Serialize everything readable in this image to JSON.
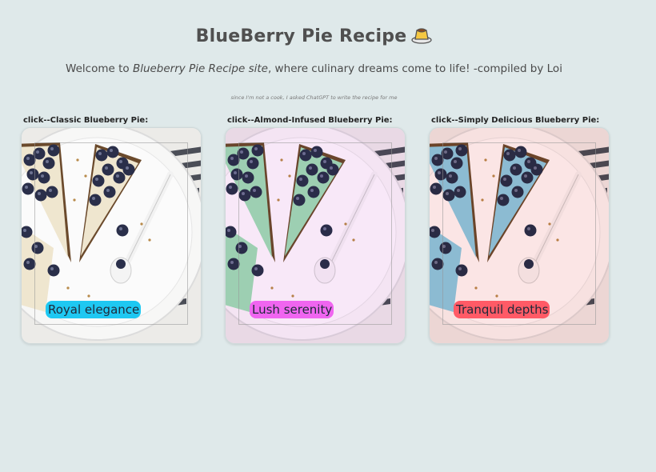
{
  "header": {
    "title": "BlueBerry Pie Recipe",
    "welcome_prefix": "Welcome to ",
    "welcome_site": "Blueberry Pie Recipe site",
    "welcome_suffix": ", where culinary dreams come to life! -compiled by Loi",
    "disclaimer": "since I'm not a cook, I asked ChatGPT to write the recipe for me"
  },
  "cards": [
    {
      "caption": "click--Classic Blueberry Pie:",
      "badge": "Royal elegance",
      "badge_color": "#1ec8f2",
      "tint": "none",
      "filling_color": "#efe6cf"
    },
    {
      "caption": "click--Almond-Infused Blueberry Pie:",
      "badge": "Lush serenity",
      "badge_color": "#f065f0",
      "tint": "#f4b8f4",
      "filling_color": "#9fe0b4"
    },
    {
      "caption": "click--Simply Delicious Blueberry Pie:",
      "badge": "Tranquil depths",
      "badge_color": "#ff5a66",
      "tint": "#ffb0b0",
      "filling_color": "#8ccde6"
    }
  ],
  "icons": {
    "title_emoji": "custard-pudding-icon"
  }
}
